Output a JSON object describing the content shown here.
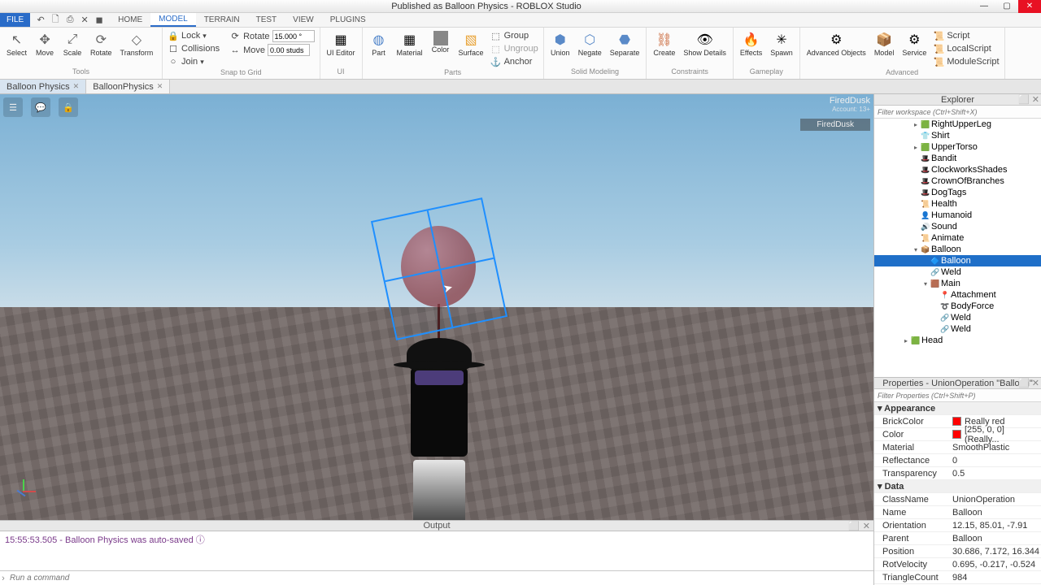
{
  "window": {
    "title": "Published as Balloon Physics - ROBLOX Studio"
  },
  "file_label": "FILE",
  "menu_tabs": [
    "HOME",
    "MODEL",
    "TERRAIN",
    "TEST",
    "VIEW",
    "PLUGINS"
  ],
  "menu_active": 1,
  "qat": [
    "↶",
    "🗋",
    "⎙",
    "✕",
    "◼"
  ],
  "ribbon": {
    "tools": {
      "label": "Tools",
      "items": [
        "Select",
        "Move",
        "Scale",
        "Rotate",
        "Transform"
      ]
    },
    "clipboard": {
      "lock": "Lock",
      "collisions": "Collisions",
      "join": "Join"
    },
    "snap": {
      "label": "Snap to Grid",
      "rotate": "Rotate",
      "rotate_v": "15.000 °",
      "move": "Move",
      "move_v": "0.00 studs"
    },
    "ui": {
      "label": "UI",
      "editor": "UI\nEditor"
    },
    "parts": {
      "label": "Parts",
      "part": "Part",
      "material": "Material",
      "color": "Color",
      "surface": "Surface",
      "group": "Group",
      "ungroup": "Ungroup",
      "anchor": "Anchor"
    },
    "solid": {
      "label": "Solid Modeling",
      "union": "Union",
      "negate": "Negate",
      "separate": "Separate"
    },
    "constraints": {
      "label": "Constraints",
      "create": "Create",
      "show": "Show\nDetails"
    },
    "gameplay": {
      "label": "Gameplay",
      "effects": "Effects",
      "spawn": "Spawn"
    },
    "advanced": {
      "label": "Advanced",
      "adv": "Advanced\nObjects",
      "model": "Model",
      "service": "Service",
      "script": "Script",
      "local": "LocalScript",
      "module": "ModuleScript"
    }
  },
  "doctabs": [
    {
      "label": "Balloon Physics"
    },
    {
      "label": "BalloonPhysics"
    }
  ],
  "user": {
    "name": "FiredDusk",
    "age": "Account: 13+",
    "tag": "FiredDusk"
  },
  "output": {
    "header": "Output",
    "line": "15:55:53.505 - Balloon Physics was auto-saved ⓘ"
  },
  "cmd_placeholder": "Run a command",
  "explorer": {
    "header": "Explorer",
    "filter": "Filter workspace (Ctrl+Shift+X)",
    "nodes": [
      {
        "d": 3,
        "a": "▸",
        "i": "🟩",
        "t": "RightUpperLeg"
      },
      {
        "d": 3,
        "a": "",
        "i": "👕",
        "t": "Shirt"
      },
      {
        "d": 3,
        "a": "▸",
        "i": "🟩",
        "t": "UpperTorso"
      },
      {
        "d": 3,
        "a": "",
        "i": "🎩",
        "t": "Bandit"
      },
      {
        "d": 3,
        "a": "",
        "i": "🎩",
        "t": "ClockworksShades"
      },
      {
        "d": 3,
        "a": "",
        "i": "🎩",
        "t": "CrownOfBranches"
      },
      {
        "d": 3,
        "a": "",
        "i": "🎩",
        "t": "DogTags"
      },
      {
        "d": 3,
        "a": "",
        "i": "📜",
        "t": "Health"
      },
      {
        "d": 3,
        "a": "",
        "i": "👤",
        "t": "Humanoid"
      },
      {
        "d": 3,
        "a": "",
        "i": "🔊",
        "t": "Sound"
      },
      {
        "d": 3,
        "a": "",
        "i": "📜",
        "t": "Animate"
      },
      {
        "d": 3,
        "a": "▾",
        "i": "📦",
        "t": "Balloon"
      },
      {
        "d": 4,
        "a": "",
        "i": "🔷",
        "t": "Balloon",
        "sel": true
      },
      {
        "d": 4,
        "a": "",
        "i": "🔗",
        "t": "Weld"
      },
      {
        "d": 4,
        "a": "▾",
        "i": "🟫",
        "t": "Main"
      },
      {
        "d": 5,
        "a": "",
        "i": "📍",
        "t": "Attachment"
      },
      {
        "d": 5,
        "a": "",
        "i": "➰",
        "t": "BodyForce"
      },
      {
        "d": 5,
        "a": "",
        "i": "🔗",
        "t": "Weld"
      },
      {
        "d": 5,
        "a": "",
        "i": "🔗",
        "t": "Weld"
      },
      {
        "d": 2,
        "a": "▸",
        "i": "🟩",
        "t": "Head"
      }
    ]
  },
  "properties": {
    "header": "Properties - UnionOperation \"Balloon\"",
    "filter": "Filter Properties (Ctrl+Shift+P)",
    "rows": [
      {
        "cat": true,
        "k": "Appearance"
      },
      {
        "k": "BrickColor",
        "v": "Really red",
        "c": "#ff0000"
      },
      {
        "k": "Color",
        "v": "[255, 0, 0] (Really...",
        "c": "#ff0000"
      },
      {
        "k": "Material",
        "v": "SmoothPlastic"
      },
      {
        "k": "Reflectance",
        "v": "0"
      },
      {
        "k": "Transparency",
        "v": "0.5"
      },
      {
        "cat": true,
        "k": "Data"
      },
      {
        "k": "ClassName",
        "v": "UnionOperation"
      },
      {
        "k": "Name",
        "v": "Balloon"
      },
      {
        "k": "Orientation",
        "v": "12.15, 85.01, -7.91"
      },
      {
        "k": "Parent",
        "v": "Balloon"
      },
      {
        "k": "Position",
        "v": "30.686, 7.172, 16.344"
      },
      {
        "k": "RotVelocity",
        "v": "0.695, -0.217, -0.524"
      },
      {
        "k": "TriangleCount",
        "v": "984"
      }
    ]
  }
}
